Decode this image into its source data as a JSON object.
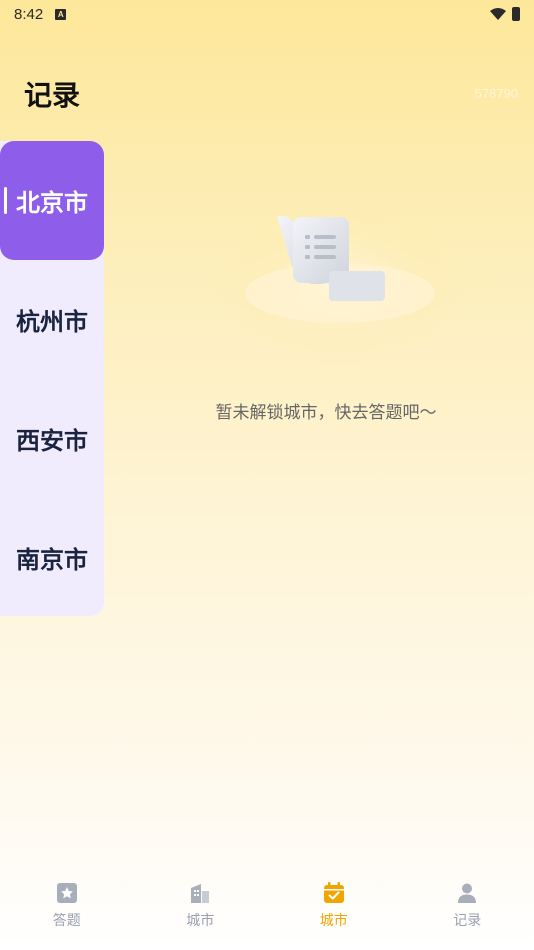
{
  "status_bar": {
    "time": "8:42",
    "notification_glyph": "A"
  },
  "header": {
    "title": "记录",
    "faint_text": "578790"
  },
  "sidebar": {
    "items": [
      {
        "label": "北京市",
        "active": true
      },
      {
        "label": "杭州市",
        "active": false
      },
      {
        "label": "西安市",
        "active": false
      },
      {
        "label": "南京市",
        "active": false
      }
    ]
  },
  "main": {
    "empty_message": "暂未解锁城市，快去答题吧～",
    "illustration_icon": "scroll-list-icon"
  },
  "tab_bar": {
    "tabs": [
      {
        "label": "答题",
        "icon": "star-card-icon",
        "active": false
      },
      {
        "label": "城市",
        "icon": "building-icon",
        "active": false
      },
      {
        "label": "城市",
        "icon": "calendar-check-icon",
        "active": true
      },
      {
        "label": "记录",
        "icon": "person-icon",
        "active": false
      }
    ]
  },
  "colors": {
    "accent_purple": "#8e5eea",
    "sidebar_bg": "#f1ecfd",
    "active_tab": "#f0a500",
    "inactive_tab": "#9aa0b0"
  }
}
